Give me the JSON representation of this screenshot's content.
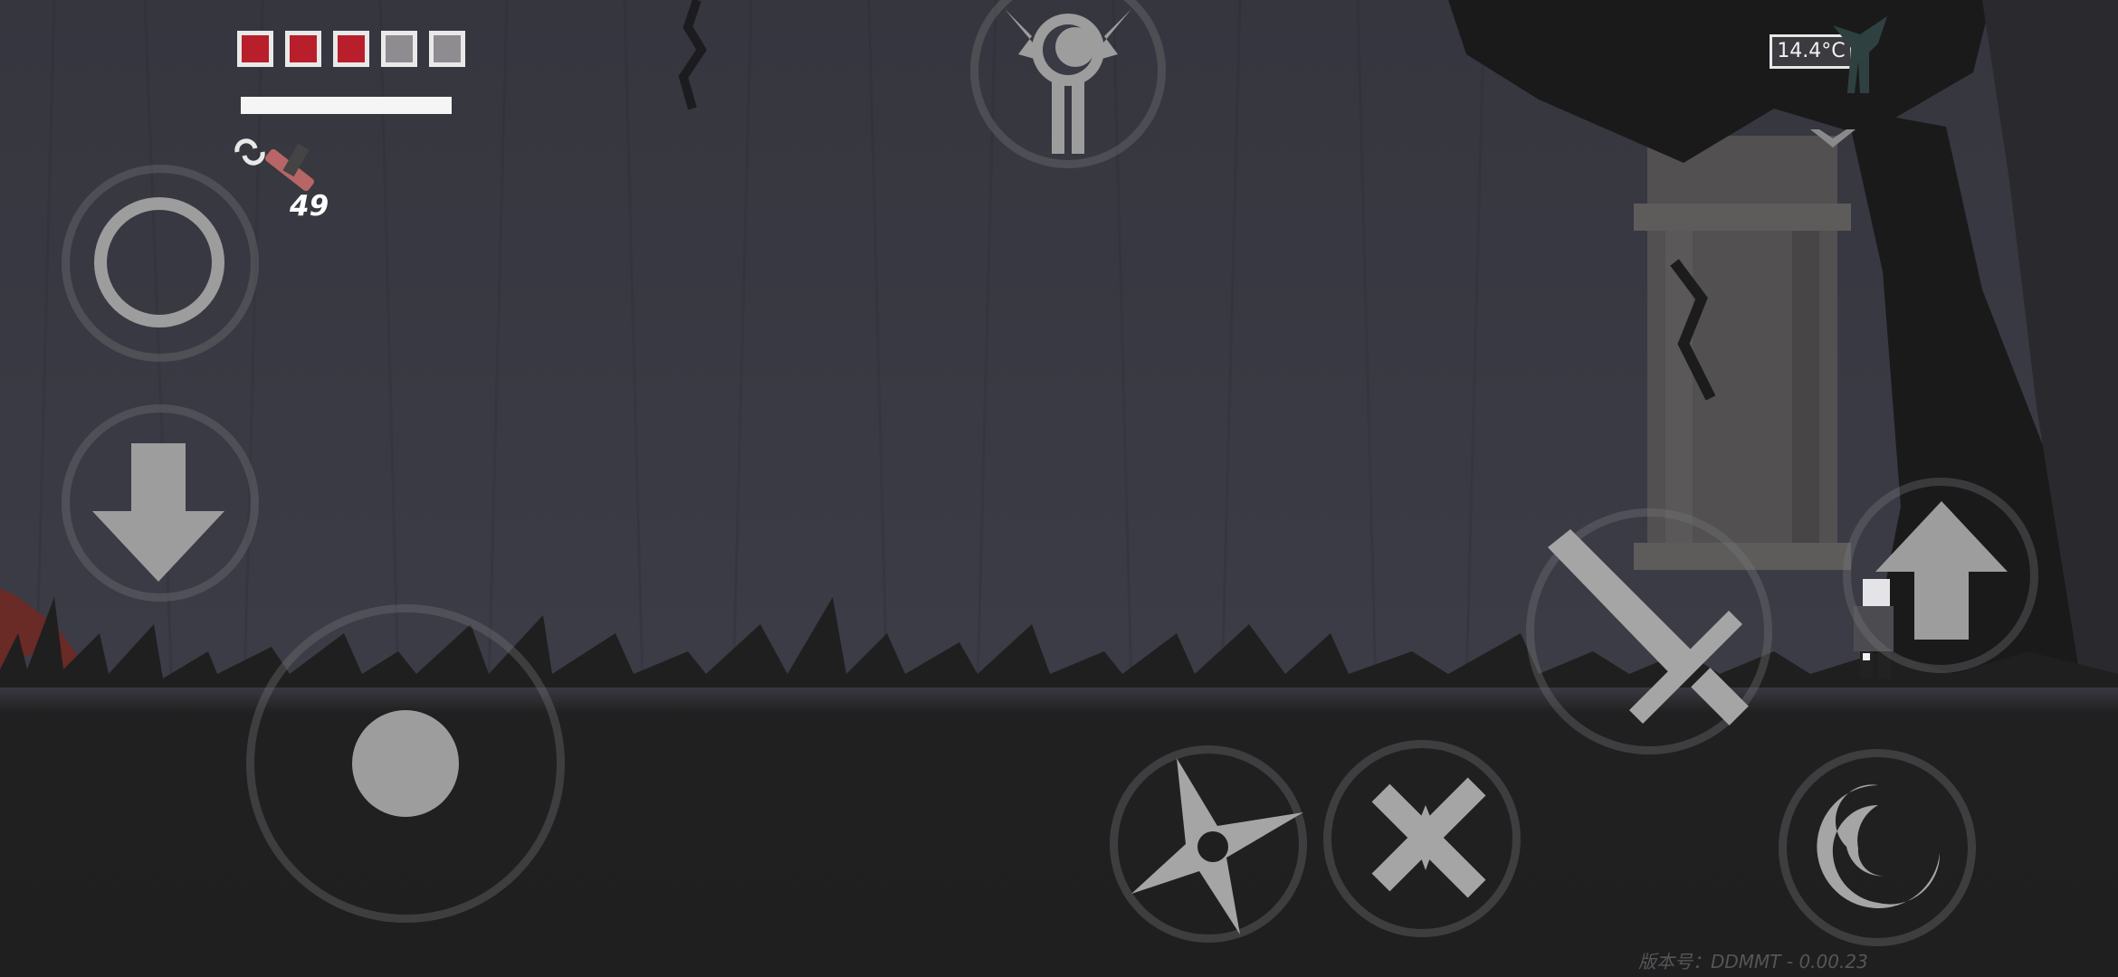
{
  "hud": {
    "health_cells": [
      {
        "state": "full",
        "color": "#b81f2b"
      },
      {
        "state": "full",
        "color": "#b81f2b"
      },
      {
        "state": "full",
        "color": "#b81f2b"
      },
      {
        "state": "empty",
        "color": "#8e8c90"
      },
      {
        "state": "empty",
        "color": "#8e8c90"
      }
    ],
    "health_filled": 3,
    "health_total": 5,
    "stamina_fraction": 1.0,
    "ammo": {
      "count": "49",
      "icon": "syringe-icon",
      "swap_icon": "swap-cycle-icon"
    },
    "temperature": "14.4°C",
    "emblem": "crescent-moon-wings-emblem",
    "dropdown_icon": "chevron-down-icon"
  },
  "controls": {
    "joystick": "movement-joystick",
    "left_buttons": [
      "circle-button-icon",
      "down-arrow-icon"
    ],
    "right_buttons": [
      "sword-attack-icon",
      "up-arrow-jump-icon",
      "shuriken-throw-icon",
      "crossed-blades-parry-icon",
      "spiral-dash-icon"
    ]
  },
  "version_text": "版本号：DDMMT - 0.00.23",
  "colors": {
    "sky": "#3a3a44",
    "ground": "#1f1f20",
    "health_red": "#b81f2b",
    "control_gray": "#9a9a9a"
  }
}
